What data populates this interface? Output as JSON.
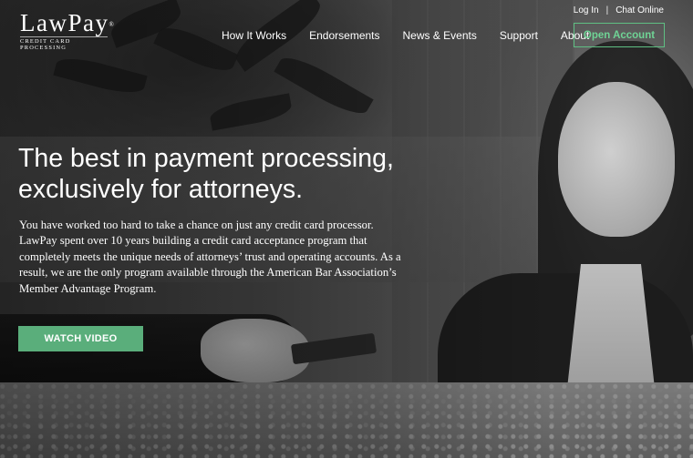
{
  "brand": {
    "name": "LawPay",
    "trademark": "®",
    "tagline": "CREDIT CARD PROCESSING"
  },
  "utility_nav": {
    "login": "Log In",
    "separator": "|",
    "chat": "Chat Online"
  },
  "main_nav": {
    "items": [
      "How It Works",
      "Endorsements",
      "News & Events",
      "Support",
      "About"
    ],
    "cta": "Open Account"
  },
  "hero": {
    "headline_line1": "The best in payment processing,",
    "headline_line2": "exclusively for attorneys.",
    "body": "You have worked too hard to take a chance on just any credit card processor. LawPay spent over 10 years building a credit card acceptance program that completely meets the unique needs of attorneys’ trust and operating accounts. As a result, we are the only program available through the American Bar Association’s Member Advantage Program.",
    "button": "WATCH VIDEO"
  },
  "colors": {
    "accent_green": "#5aae7b",
    "cta_border": "#5fbf83"
  }
}
